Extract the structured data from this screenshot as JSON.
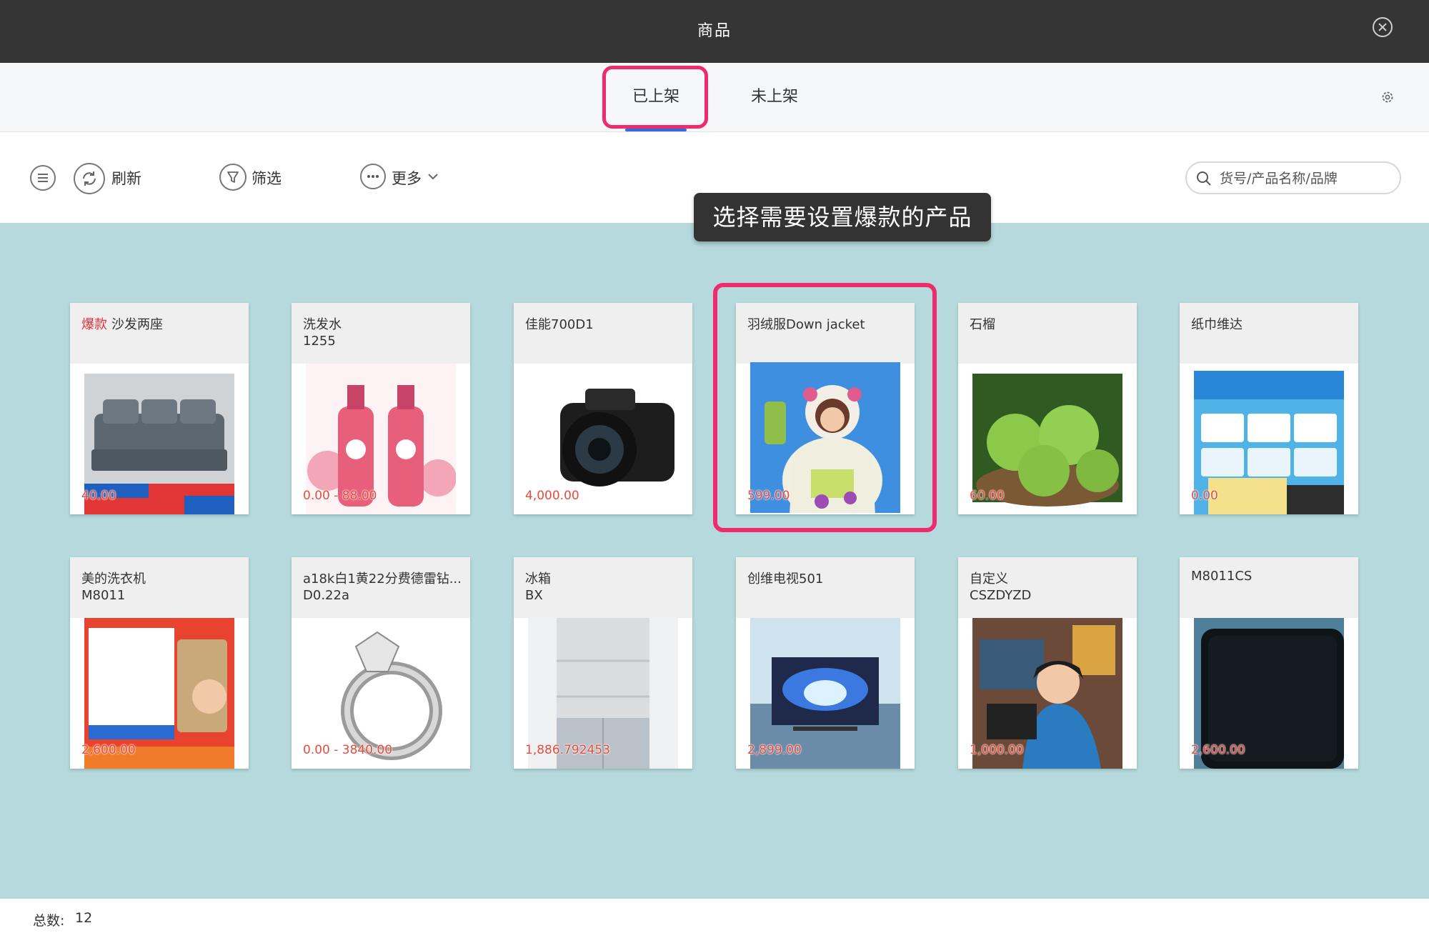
{
  "window": {
    "title": "商品"
  },
  "tabs": [
    {
      "label": "已上架",
      "active": true
    },
    {
      "label": "未上架",
      "active": false
    }
  ],
  "toolbar": {
    "refresh_label": "刷新",
    "filter_label": "筛选",
    "more_label": "更多",
    "search_placeholder": "货号/产品名称/品牌"
  },
  "tooltip": "选择需要设置爆款的产品",
  "products": [
    {
      "badge": "爆款",
      "name": "沙发两座",
      "code": "",
      "price": "40.00",
      "image": "sofa"
    },
    {
      "badge": "",
      "name": "洗发水",
      "code": "1255",
      "price": "0.00 - 88.00",
      "image": "shampoo"
    },
    {
      "badge": "",
      "name": "佳能700D1",
      "code": "",
      "price": "4,000.00",
      "image": "camera"
    },
    {
      "badge": "",
      "name": "羽绒服Down jacket",
      "code": "",
      "price": "599.00",
      "image": "jacket"
    },
    {
      "badge": "",
      "name": "石榴",
      "code": "",
      "price": "60.00",
      "image": "fruit"
    },
    {
      "badge": "",
      "name": "纸巾维达",
      "code": "",
      "price": "0.00",
      "image": "tissue"
    },
    {
      "badge": "",
      "name": "美的洗衣机",
      "code": "M8011",
      "price": "2,600.00",
      "image": "washer"
    },
    {
      "badge": "",
      "name": "a18k白1黄22分费德雷钻...",
      "code": "D0.22a",
      "price": "0.00 - 3840.00",
      "image": "ring"
    },
    {
      "badge": "",
      "name": "冰箱",
      "code": "BX",
      "price": "1,886.792453",
      "image": "fridge"
    },
    {
      "badge": "",
      "name": "创维电视501",
      "code": "",
      "price": "2,899.00",
      "image": "tv"
    },
    {
      "badge": "",
      "name": "自定义",
      "code": "CSZDYZD",
      "price": "1,000.00",
      "image": "programmer"
    },
    {
      "badge": "",
      "name": "M8011CS",
      "code": "",
      "price": "2,600.00",
      "image": "phone"
    }
  ],
  "footer": {
    "total_label": "总数:",
    "total_value": "12"
  },
  "colors": {
    "accent": "#2f6de0",
    "highlight": "#ee2b6c",
    "price": "#e84a3c",
    "hot": "#e8313b",
    "grid_bg": "#b5d9dc"
  },
  "icons": {
    "close": "close-circle-icon",
    "settings": "gear-icon",
    "menu": "menu-icon",
    "refresh": "refresh-icon",
    "filter": "filter-icon",
    "more": "more-icon",
    "search": "search-icon"
  }
}
